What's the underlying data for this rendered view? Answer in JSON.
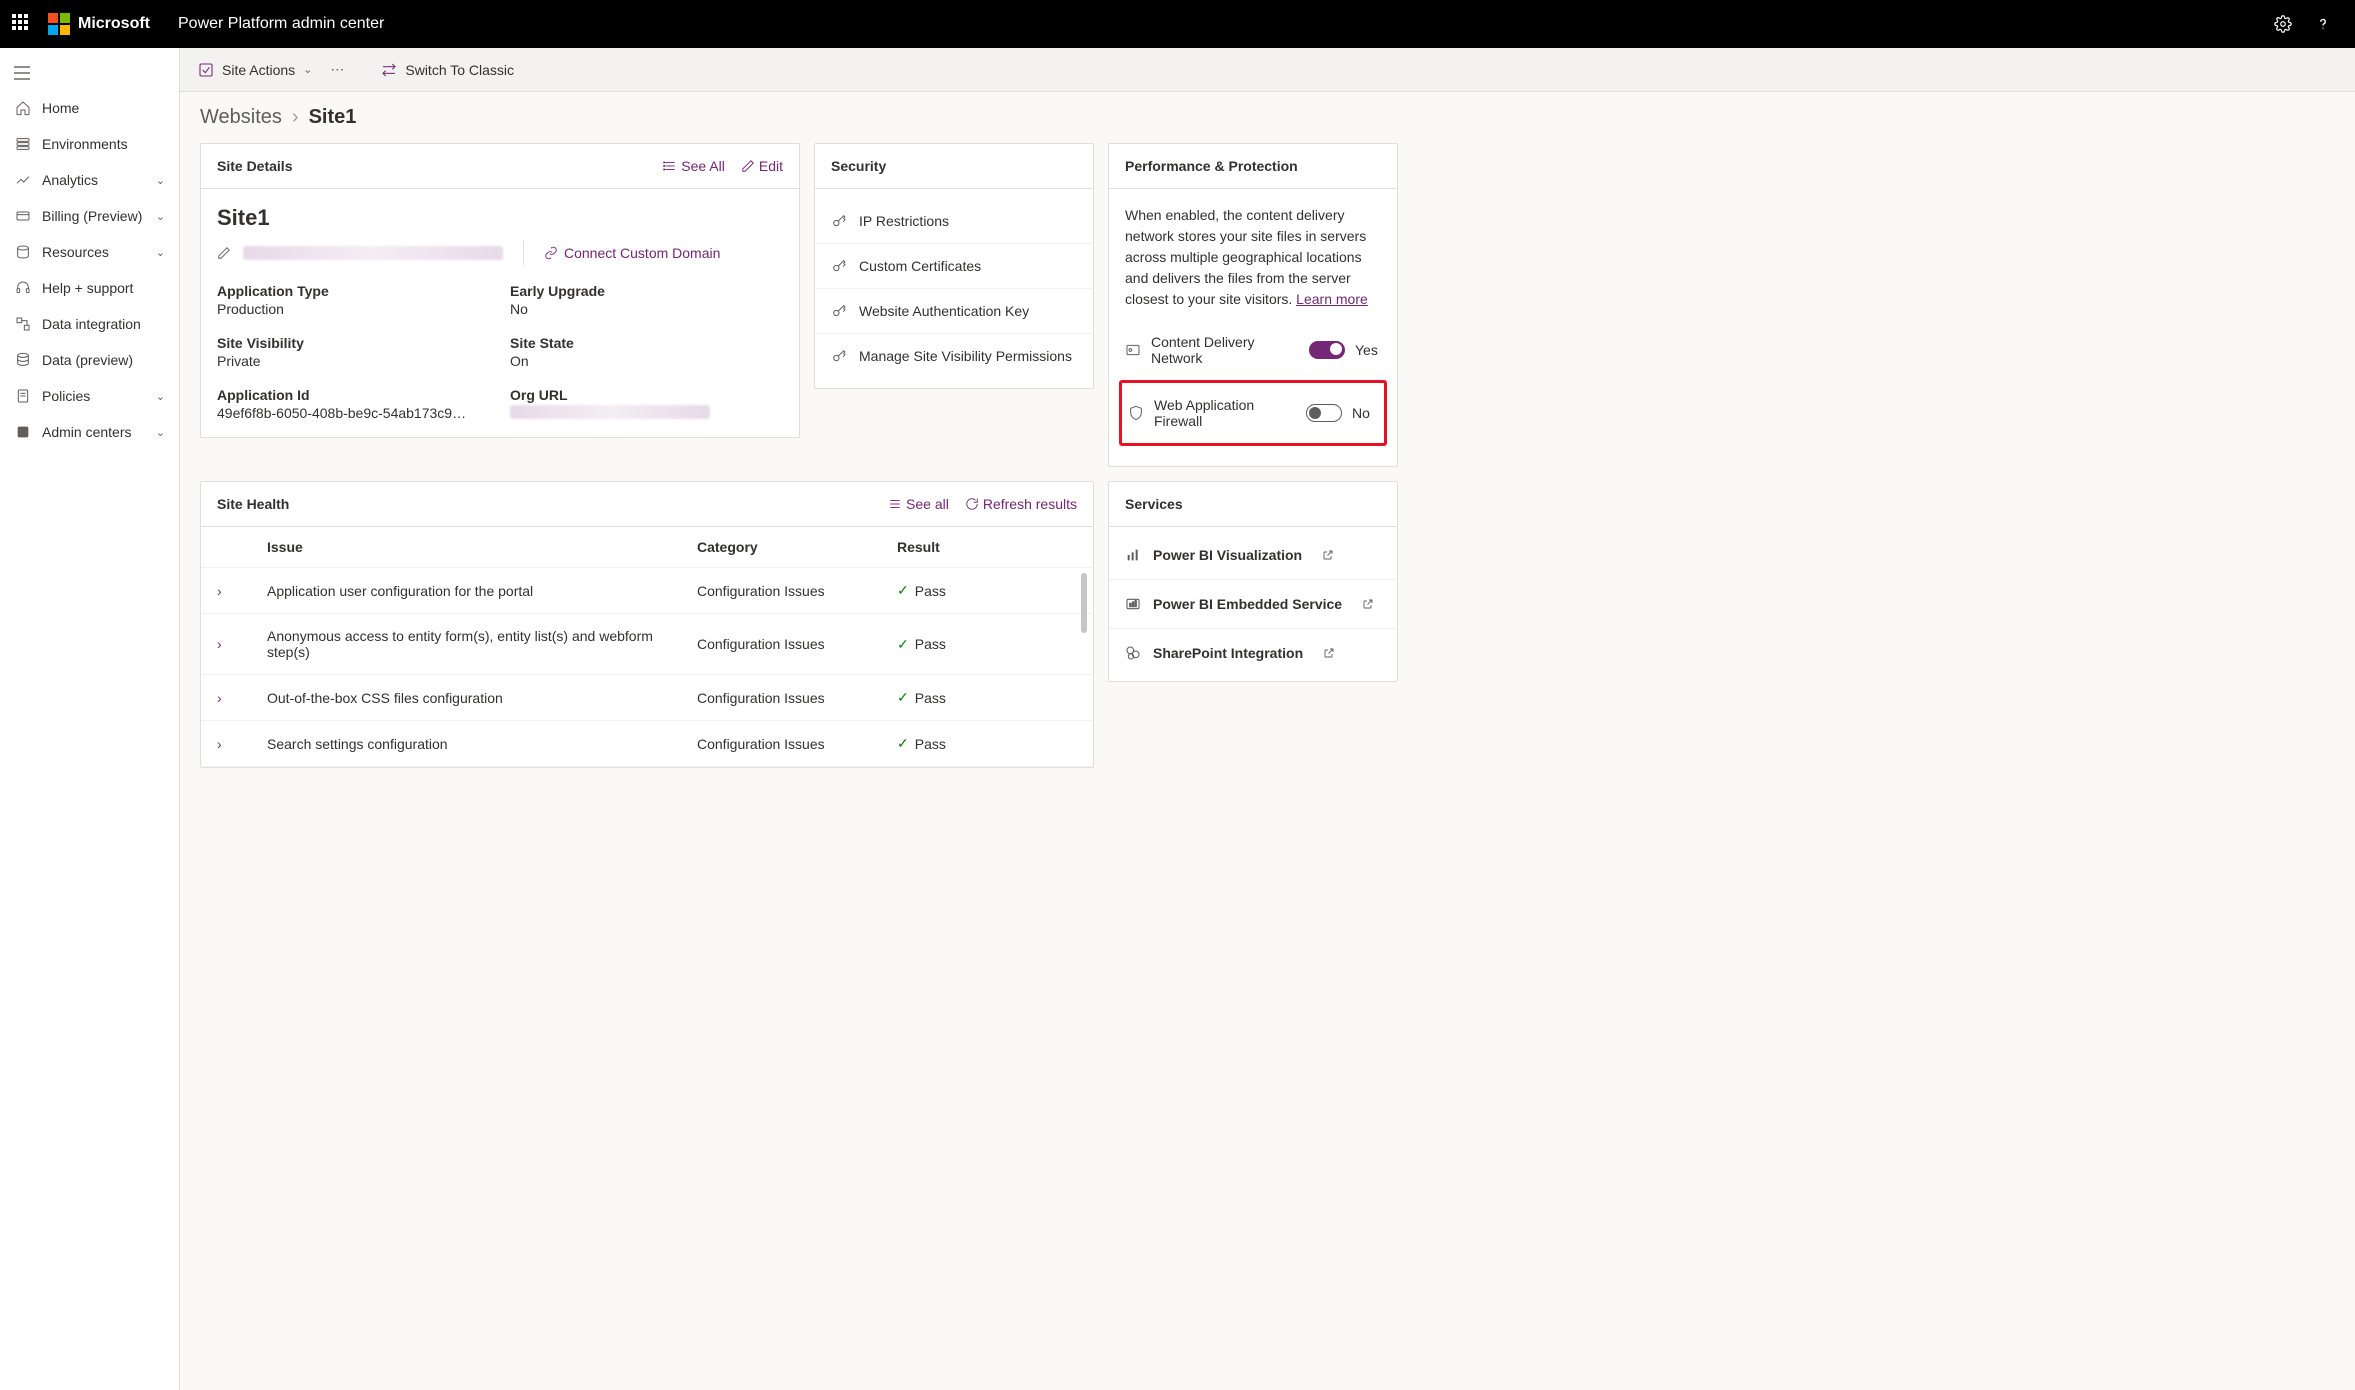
{
  "header": {
    "brand": "Microsoft",
    "app": "Power Platform admin center"
  },
  "nav": {
    "items": [
      {
        "label": "Home",
        "icon": "home",
        "expandable": false
      },
      {
        "label": "Environments",
        "icon": "environments",
        "expandable": false
      },
      {
        "label": "Analytics",
        "icon": "analytics",
        "expandable": true
      },
      {
        "label": "Billing (Preview)",
        "icon": "billing",
        "expandable": true
      },
      {
        "label": "Resources",
        "icon": "resources",
        "expandable": true
      },
      {
        "label": "Help + support",
        "icon": "help",
        "expandable": false
      },
      {
        "label": "Data integration",
        "icon": "dataint",
        "expandable": false
      },
      {
        "label": "Data (preview)",
        "icon": "datapreview",
        "expandable": false
      },
      {
        "label": "Policies",
        "icon": "policies",
        "expandable": true
      },
      {
        "label": "Admin centers",
        "icon": "admin",
        "expandable": true
      }
    ]
  },
  "cmdbar": {
    "site_actions": "Site Actions",
    "switch": "Switch To Classic"
  },
  "breadcrumb": {
    "root": "Websites",
    "current": "Site1"
  },
  "site_details": {
    "title": "Site Details",
    "see_all": "See All",
    "edit": "Edit",
    "site_name": "Site1",
    "connect_domain": "Connect Custom Domain",
    "fields": {
      "application_type_label": "Application Type",
      "application_type_value": "Production",
      "early_upgrade_label": "Early Upgrade",
      "early_upgrade_value": "No",
      "site_visibility_label": "Site Visibility",
      "site_visibility_value": "Private",
      "site_state_label": "Site State",
      "site_state_value": "On",
      "application_id_label": "Application Id",
      "application_id_value": "49ef6f8b-6050-408b-be9c-54ab173c9…",
      "org_url_label": "Org URL"
    }
  },
  "security": {
    "title": "Security",
    "items": [
      "IP Restrictions",
      "Custom Certificates",
      "Website Authentication Key",
      "Manage Site Visibility Permissions"
    ]
  },
  "perf": {
    "title": "Performance & Protection",
    "desc": "When enabled, the content delivery network stores your site files in servers across multiple geographical locations and delivers the files from the server closest to your site visitors. ",
    "learn_more": "Learn more",
    "cdn_label": "Content Delivery Network",
    "cdn_state": "Yes",
    "waf_label": "Web Application Firewall",
    "waf_state": "No"
  },
  "health": {
    "title": "Site Health",
    "see_all": "See all",
    "refresh": "Refresh results",
    "cols": {
      "issue": "Issue",
      "category": "Category",
      "result": "Result"
    },
    "rows": [
      {
        "issue": "Application user configuration for the portal",
        "category": "Configuration Issues",
        "result": "Pass"
      },
      {
        "issue": "Anonymous access to entity form(s), entity list(s) and webform step(s)",
        "category": "Configuration Issues",
        "result": "Pass"
      },
      {
        "issue": "Out-of-the-box CSS files configuration",
        "category": "Configuration Issues",
        "result": "Pass"
      },
      {
        "issue": "Search settings configuration",
        "category": "Configuration Issues",
        "result": "Pass"
      }
    ]
  },
  "services": {
    "title": "Services",
    "items": [
      "Power BI Visualization",
      "Power BI Embedded Service",
      "SharePoint Integration"
    ]
  }
}
